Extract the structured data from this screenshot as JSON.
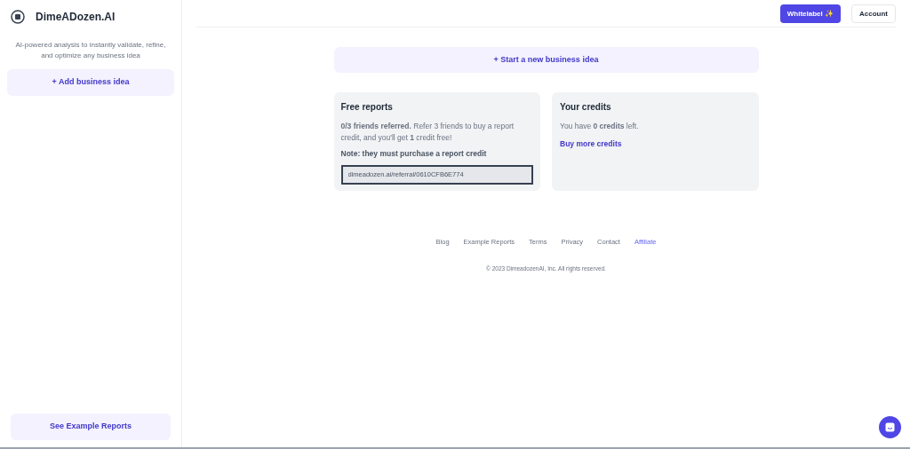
{
  "sidebar": {
    "logo": "DimeADozen.AI",
    "tagline": "AI-powered analysis to instantly validate, refine, and optimize any business idea",
    "add_button": "+ Add business idea",
    "bottom_button": "See Example Reports"
  },
  "header": {
    "buttons": [
      {
        "label": "Whitelabel ✨",
        "kind": "primary"
      },
      {
        "label": "Account",
        "kind": "outline"
      }
    ]
  },
  "start_button": "+ Start a new business idea",
  "free_reports": {
    "title": "Free reports",
    "text": "**0/3 friends referred.** Refer 3 friends to buy a report credit, and you'll get **1** credit free!",
    "note": "Note: they must purchase a report credit",
    "referral_link": "dimeadozen.ai/referral/0610CFB6E774"
  },
  "credits": {
    "title": "Your credits",
    "text": "You have **0 credits** left.",
    "link": "Buy more credits"
  },
  "footer": {
    "links": [
      {
        "label": "Blog",
        "selected": false
      },
      {
        "label": "Example Reports",
        "selected": false
      },
      {
        "label": "Terms",
        "selected": false
      },
      {
        "label": "Privacy",
        "selected": false
      },
      {
        "label": "Contact",
        "selected": false
      },
      {
        "label": "Affiliate",
        "selected": true
      }
    ],
    "copyright": "© 2023 DimeadozenAI, Inc. All rights reserved."
  }
}
